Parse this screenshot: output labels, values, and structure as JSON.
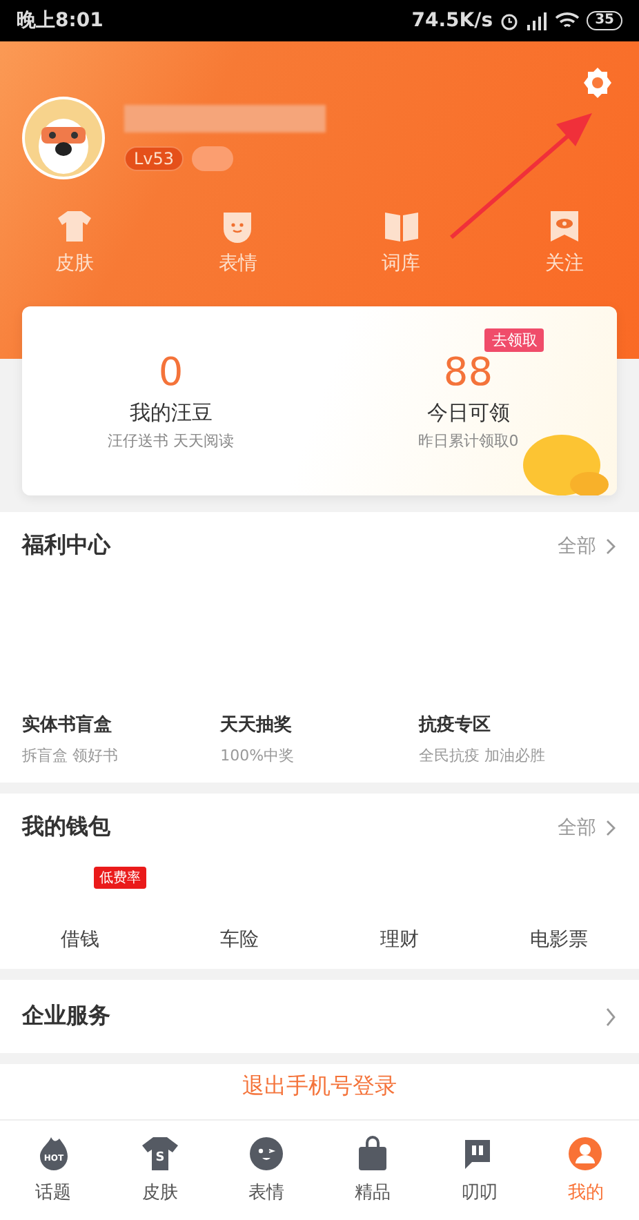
{
  "status_bar": {
    "time": "晚上8:01",
    "speed": "74.5K/s",
    "battery": "35"
  },
  "profile": {
    "level": "Lv53"
  },
  "header_shortcuts": [
    {
      "kind": "shirt",
      "label": "皮肤"
    },
    {
      "kind": "face",
      "label": "表情"
    },
    {
      "kind": "book",
      "label": "词库"
    },
    {
      "kind": "eye",
      "label": "关注"
    }
  ],
  "beans_card": {
    "stats": [
      {
        "value": "0",
        "label": "我的汪豆",
        "sub": "汪仔送书 天天阅读"
      },
      {
        "value": "88",
        "label": "今日可领",
        "sub": "昨日累计领取0",
        "tag": "去领取"
      }
    ]
  },
  "welfare": {
    "title": "福利中心",
    "more": "全部",
    "items": [
      {
        "title": "实体书盲盒",
        "sub": "拆盲盒 领好书"
      },
      {
        "title": "天天抽奖",
        "sub": "100%中奖"
      },
      {
        "title": "抗疫专区",
        "sub": "全民抗疫 加油必胜"
      }
    ]
  },
  "wallet": {
    "title": "我的钱包",
    "more": "全部",
    "items": [
      {
        "label": "借钱",
        "tag": "低费率"
      },
      {
        "label": "车险"
      },
      {
        "label": "理财"
      },
      {
        "label": "电影票"
      }
    ]
  },
  "enterprise": {
    "title": "企业服务"
  },
  "logout": "退出手机号登录",
  "bottom_nav": [
    {
      "kind": "hot",
      "label": "话题",
      "badge_text": "HOT",
      "selected": false
    },
    {
      "kind": "shirt",
      "label": "皮肤",
      "badge_text": "S",
      "selected": false
    },
    {
      "kind": "face",
      "label": "表情",
      "selected": false
    },
    {
      "kind": "bag",
      "label": "精品",
      "selected": false
    },
    {
      "kind": "chat",
      "label": "叨叨",
      "selected": false
    },
    {
      "kind": "user",
      "label": "我的",
      "selected": true
    }
  ]
}
